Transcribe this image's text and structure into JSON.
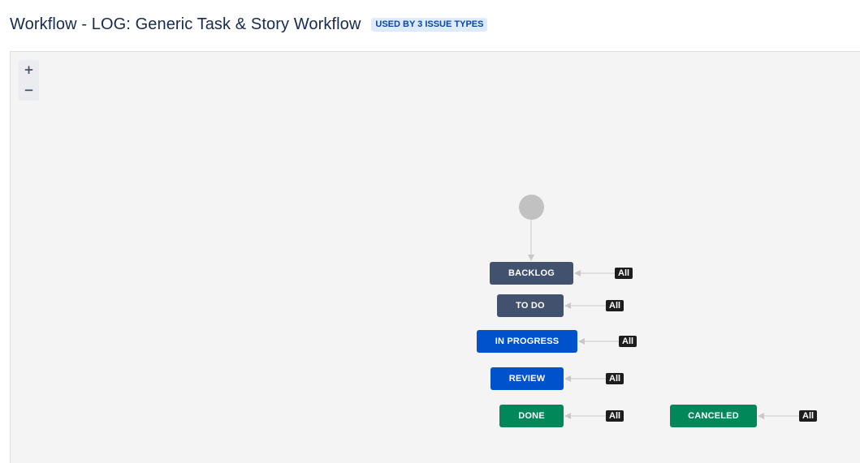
{
  "header": {
    "title": "Workflow - LOG: Generic Task & Story Workflow",
    "badge": "USED BY 3 ISSUE TYPES"
  },
  "zoom": {
    "in_label": "+",
    "out_label": "−"
  },
  "statuses": [
    {
      "label": "BACKLOG",
      "category": "todo",
      "global_transition": "All"
    },
    {
      "label": "TO DO",
      "category": "todo",
      "global_transition": "All"
    },
    {
      "label": "IN PROGRESS",
      "category": "inprogress",
      "global_transition": "All"
    },
    {
      "label": "REVIEW",
      "category": "inprogress",
      "global_transition": "All"
    },
    {
      "label": "DONE",
      "category": "done",
      "global_transition": "All"
    },
    {
      "label": "CANCELED",
      "category": "done",
      "global_transition": "All"
    }
  ],
  "colors": {
    "todo": "#42526e",
    "inprogress": "#0052cc",
    "done": "#00875a",
    "start_node": "#c1c1c1",
    "canvas": "#f4f4f4"
  }
}
